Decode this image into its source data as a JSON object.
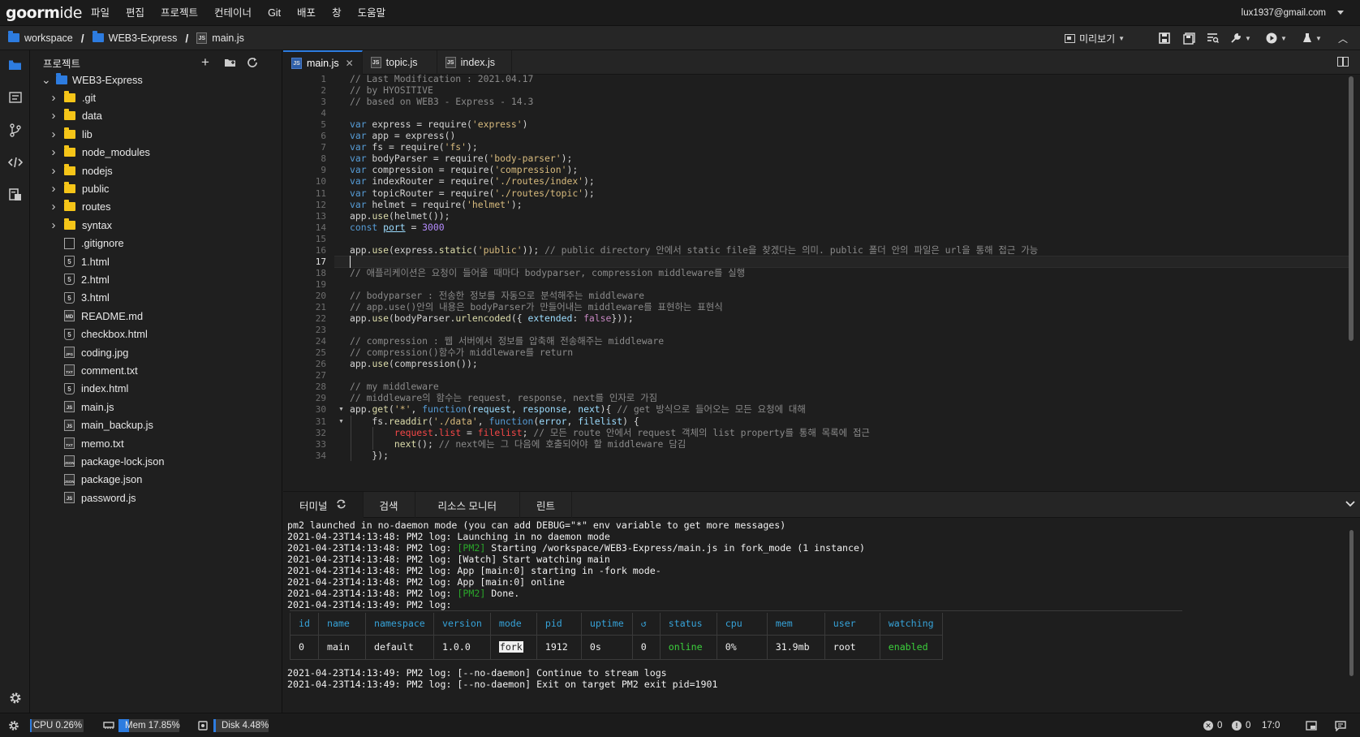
{
  "menubar": {
    "logo_bold": "goorm",
    "logo_light": "ide",
    "items": [
      "파일",
      "편집",
      "프로젝트",
      "컨테이너",
      "Git",
      "배포",
      "창",
      "도움말"
    ],
    "user_email": "lux1937@gmail.com"
  },
  "breadcrumb": {
    "workspace": "workspace",
    "project": "WEB3-Express",
    "file": "main.js"
  },
  "toolbar": {
    "preview_label": "미리보기"
  },
  "sidebar": {
    "title": "프로젝트",
    "root": "WEB3-Express",
    "folders": [
      ".git",
      "data",
      "lib",
      "node_modules",
      "nodejs",
      "public",
      "routes",
      "syntax"
    ],
    "files": [
      {
        "name": ".gitignore",
        "icon": "plain-file-icon"
      },
      {
        "name": "1.html",
        "icon": "html-file-icon"
      },
      {
        "name": "2.html",
        "icon": "html-file-icon"
      },
      {
        "name": "3.html",
        "icon": "html-file-icon"
      },
      {
        "name": "README.md",
        "icon": "md-file-icon"
      },
      {
        "name": "checkbox.html",
        "icon": "html-file-icon"
      },
      {
        "name": "coding.jpg",
        "icon": "jpg-file-icon"
      },
      {
        "name": "comment.txt",
        "icon": "txt-file-icon"
      },
      {
        "name": "index.html",
        "icon": "html-file-icon"
      },
      {
        "name": "main.js",
        "icon": "js-file-icon"
      },
      {
        "name": "main_backup.js",
        "icon": "js-file-icon"
      },
      {
        "name": "memo.txt",
        "icon": "txt-file-icon"
      },
      {
        "name": "package-lock.json",
        "icon": "json-file-icon"
      },
      {
        "name": "package.json",
        "icon": "json-file-icon"
      },
      {
        "name": "password.js",
        "icon": "js-file-icon"
      }
    ]
  },
  "tabs": [
    {
      "label": "main.js",
      "active": true
    },
    {
      "label": "topic.js",
      "active": false
    },
    {
      "label": "index.js",
      "active": false
    }
  ],
  "editor": {
    "current_line": 17,
    "lines": [
      "// Last Modification : 2021.04.17",
      "// by HYOSITIVE",
      "// based on WEB3 - Express - 14.3",
      "",
      "var express = require('express')",
      "var app = express()",
      "var fs = require('fs');",
      "var bodyParser = require('body-parser');",
      "var compression = require('compression');",
      "var indexRouter = require('./routes/index');",
      "var topicRouter = require('./routes/topic');",
      "var helmet = require('helmet');",
      "app.use(helmet());",
      "const port = 3000",
      "",
      "app.use(express.static('public')); // public directory 안에서 static file을 찾겠다는 의미. public 폴더 안의 파일은 url을 통해 접근 가능",
      "",
      "// 애플리케이션은 요청이 들어올 때마다 bodyparser, compression middleware를 실행",
      "",
      "// bodyparser : 전송한 정보를 자동으로 분석해주는 middleware",
      "// app.use()안의 내용은 bodyParser가 만들어내는 middleware를 표현하는 표현식",
      "app.use(bodyParser.urlencoded({ extended: false}));",
      "",
      "// compression : 웹 서버에서 정보를 압축해 전송해주는 middleware",
      "// compression()함수가 middleware를 return",
      "app.use(compression());",
      "",
      "// my middleware",
      "// middleware의 함수는 request, response, next를 인자로 가짐",
      "app.get('*', function(request, response, next){ // get 방식으로 들어오는 모든 요청에 대해",
      "    fs.readdir('./data', function(error, filelist) {",
      "        request.list = filelist; // 모든 route 안에서 request 객체의 list property를 통해 목록에 접근",
      "        next(); // next에는 그 다음에 호출되어야 할 middleware 담김",
      "    });"
    ]
  },
  "panel": {
    "tabs": [
      "터미널",
      "검색",
      "리소스 모니터",
      "린트"
    ],
    "terminal_lines_top": [
      "pm2 launched in no-daemon mode (you can add DEBUG=\"*\" env variable to get more messages)",
      "2021-04-23T14:13:48: PM2 log: Launching in no daemon mode"
    ],
    "pm2_tag": "[PM2]",
    "log_prefix_48": "2021-04-23T14:13:48: PM2 log: ",
    "log_prefix_49": "2021-04-23T14:13:49: PM2 log: ",
    "starting_text": " Starting /workspace/WEB3-Express/main.js in fork_mode (1 instance)",
    "watch_line": "2021-04-23T14:13:48: PM2 log: [Watch] Start watching main",
    "app_start_line": "2021-04-23T14:13:48: PM2 log: App [main:0] starting in -fork mode-",
    "app_online_line": "2021-04-23T14:13:48: PM2 log: App [main:0] online",
    "done_text": " Done.",
    "table_headers": [
      "id",
      "name",
      "namespace",
      "version",
      "mode",
      "pid",
      "uptime",
      "↺",
      "status",
      "cpu",
      "mem",
      "user",
      "watching"
    ],
    "table_row": [
      "0",
      "main",
      "default",
      "1.0.0",
      "fork",
      "1912",
      "0s",
      "0",
      "online",
      "0%",
      "31.9mb",
      "root",
      "enabled"
    ],
    "terminal_lines_bottom": [
      "2021-04-23T14:13:49: PM2 log: [--no-daemon] Continue to stream logs",
      "2021-04-23T14:13:49: PM2 log: [--no-daemon] Exit on target PM2 exit pid=1901"
    ]
  },
  "statusbar": {
    "cpu_label": "CPU",
    "cpu_value": "0.26%",
    "cpu_fraction": 0.0026,
    "mem_label": "Mem",
    "mem_value": "17.85%",
    "mem_fraction": 0.1785,
    "disk_label": "Disk",
    "disk_value": "4.48%",
    "disk_fraction": 0.0448,
    "errors": "0",
    "warnings": "0",
    "cursor_pos": "17:0"
  },
  "colors": {
    "accent": "#2d7ce0",
    "folder": "#f5c518",
    "online": "#3cd03c",
    "table_header": "#36a3d9"
  }
}
